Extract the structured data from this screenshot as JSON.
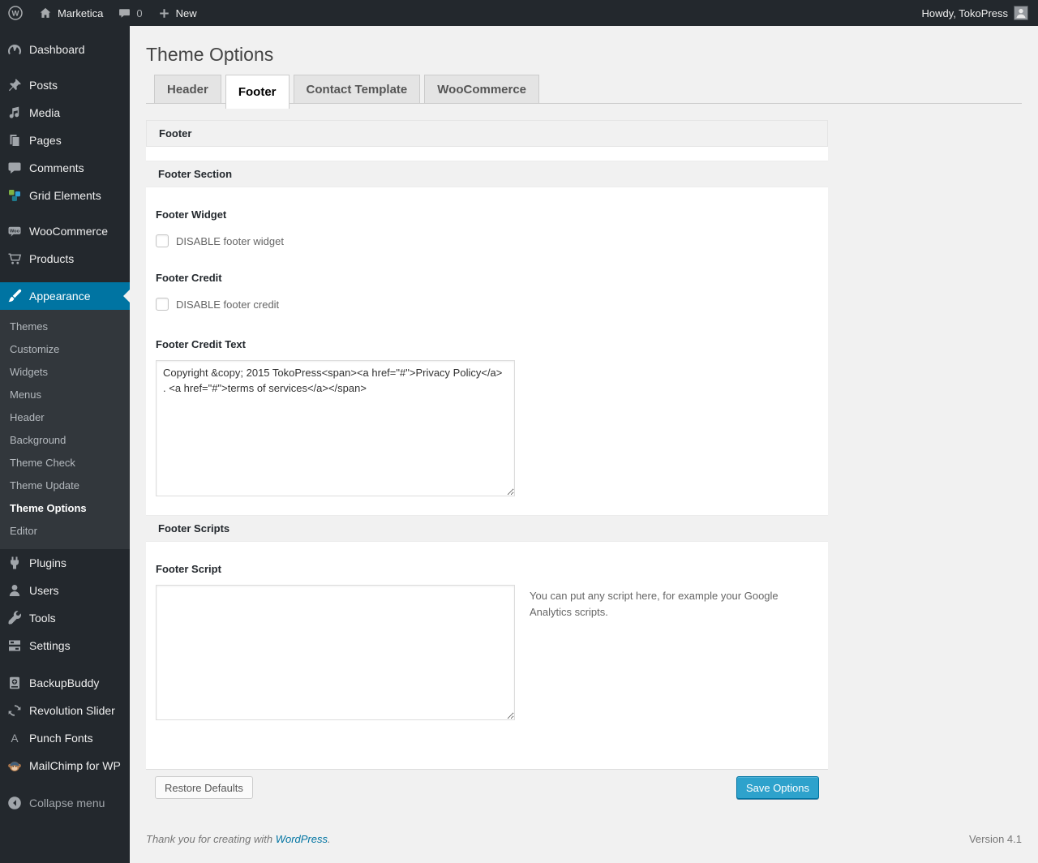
{
  "admin_bar": {
    "site_name": "Marketica",
    "comments_count": "0",
    "new_label": "New",
    "howdy": "Howdy, TokoPress"
  },
  "sidebar": {
    "items": [
      {
        "label": "Dashboard",
        "icon": "dashboard-icon"
      },
      {
        "label": "Posts",
        "icon": "pushpin-icon"
      },
      {
        "label": "Media",
        "icon": "media-icon"
      },
      {
        "label": "Pages",
        "icon": "pages-icon"
      },
      {
        "label": "Comments",
        "icon": "comments-icon"
      },
      {
        "label": "Grid Elements",
        "icon": "grid-elements-icon"
      },
      {
        "label": "WooCommerce",
        "icon": "woocommerce-icon"
      },
      {
        "label": "Products",
        "icon": "cart-icon"
      },
      {
        "label": "Appearance",
        "icon": "appearance-brush-icon"
      },
      {
        "label": "Plugins",
        "icon": "plugin-icon"
      },
      {
        "label": "Users",
        "icon": "users-icon"
      },
      {
        "label": "Tools",
        "icon": "wrench-icon"
      },
      {
        "label": "Settings",
        "icon": "settings-icon"
      },
      {
        "label": "BackupBuddy",
        "icon": "backupbuddy-icon"
      },
      {
        "label": "Revolution Slider",
        "icon": "revolution-slider-icon"
      },
      {
        "label": "Punch Fonts",
        "icon": "punch-fonts-icon"
      },
      {
        "label": "MailChimp for WP",
        "icon": "mailchimp-icon"
      },
      {
        "label": "Collapse menu",
        "icon": "collapse-arrow-icon"
      }
    ],
    "appearance_submenu": [
      "Themes",
      "Customize",
      "Widgets",
      "Menus",
      "Header",
      "Background",
      "Theme Check",
      "Theme Update",
      "Theme Options",
      "Editor"
    ]
  },
  "page": {
    "title": "Theme Options"
  },
  "tabs": [
    {
      "label": "Header"
    },
    {
      "label": "Footer"
    },
    {
      "label": "Contact Template"
    },
    {
      "label": "WooCommerce"
    }
  ],
  "panel": {
    "group_title": "Footer",
    "footer_section": {
      "title": "Footer Section",
      "widget_label": "Footer Widget",
      "widget_checkbox_label": "DISABLE footer widget",
      "credit_label": "Footer Credit",
      "credit_checkbox_label": "DISABLE footer credit",
      "credit_text_label": "Footer Credit Text",
      "credit_text_value": "Copyright &copy; 2015 TokoPress<span><a href=\"#\">Privacy Policy</a> . <a href=\"#\">terms of services</a></span>"
    },
    "footer_scripts": {
      "title": "Footer Scripts",
      "script_label": "Footer Script",
      "script_value": "",
      "script_hint": "You can put any script here, for example your Google Analytics scripts."
    },
    "actions": {
      "restore_label": "Restore Defaults",
      "save_label": "Save Options"
    }
  },
  "page_footer": {
    "thanks_prefix": "Thank you for creating with",
    "wordpress_link": "WordPress",
    "thanks_suffix": ".",
    "version": "Version 4.1"
  },
  "colors": {
    "admin_accent": "#0074a2",
    "primary_button": "#2ea2cc",
    "menu_background": "#23282d",
    "page_background": "#f1f1f1"
  }
}
